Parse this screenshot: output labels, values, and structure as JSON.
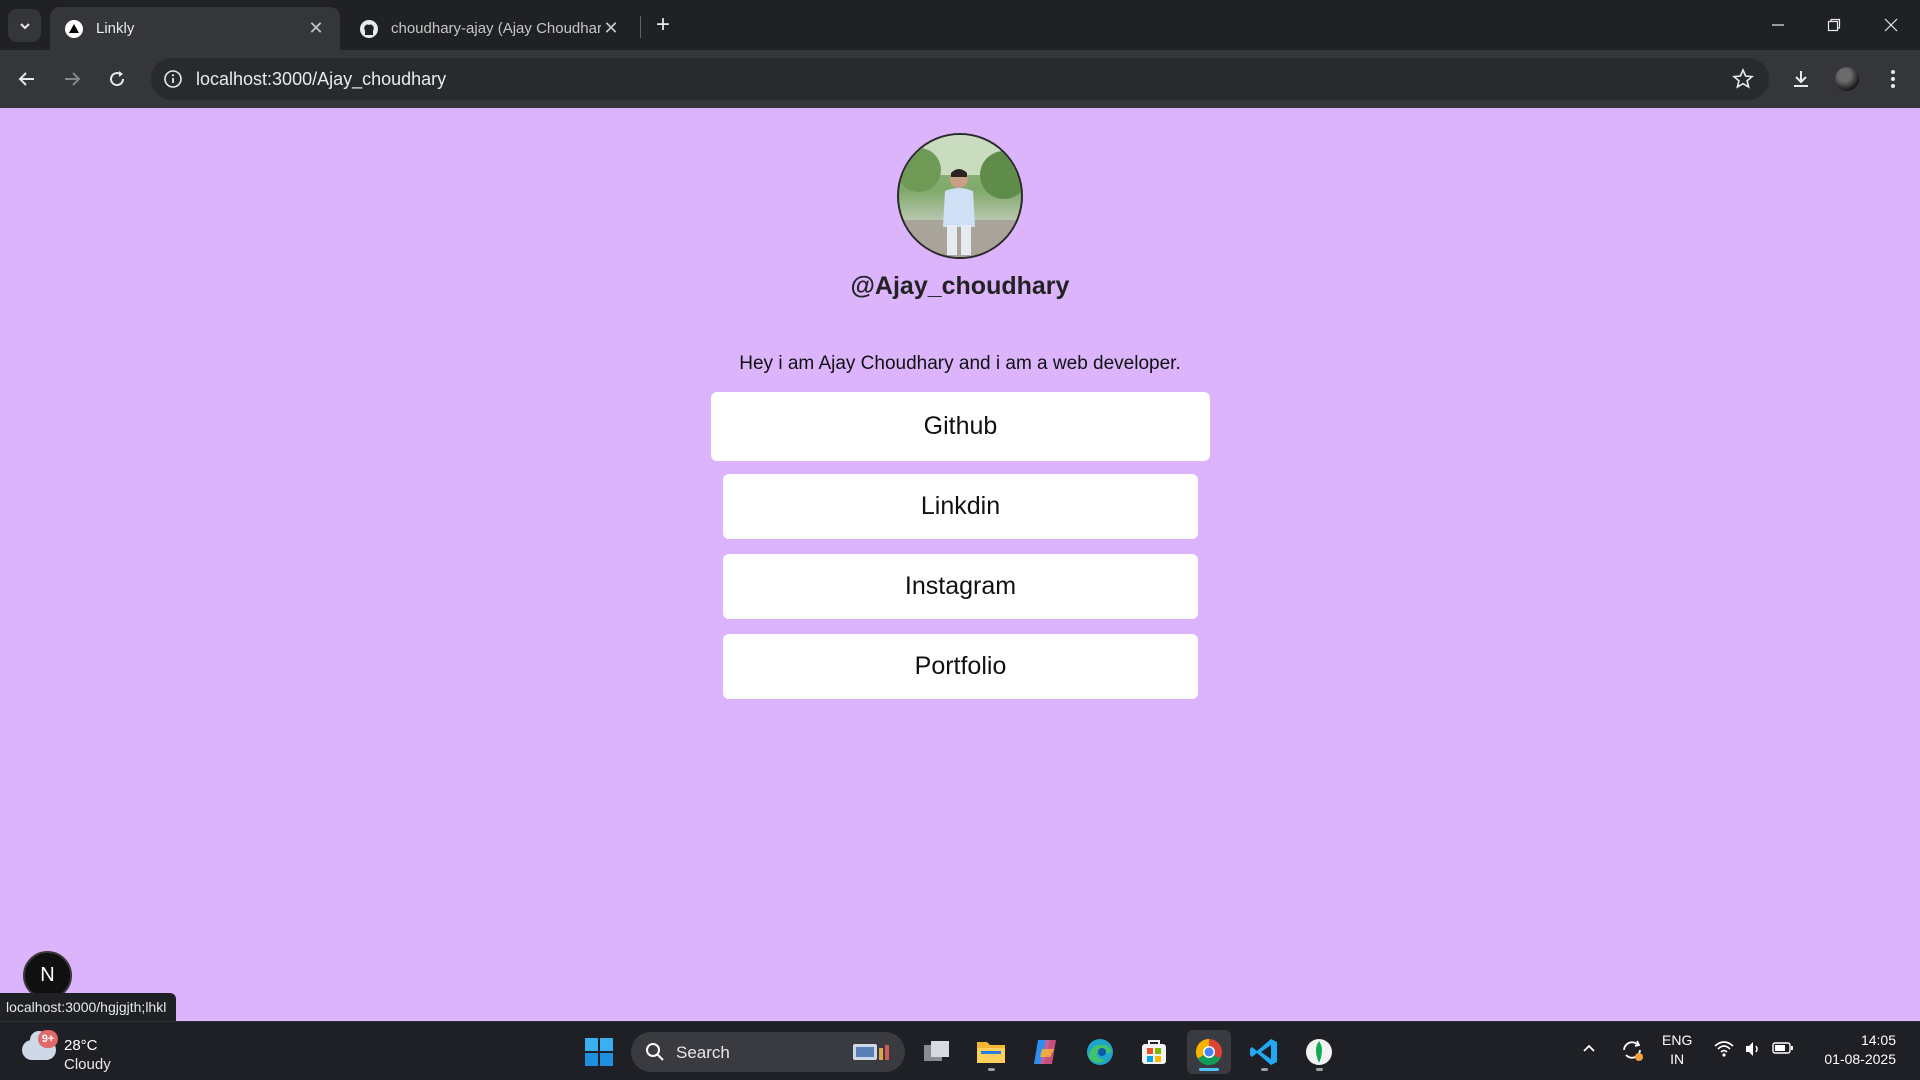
{
  "browser": {
    "tabs": [
      {
        "title": "Linkly",
        "active": true,
        "favicon": "triangle-icon"
      },
      {
        "title": "choudhary-ajay (Ajay Choudhary)",
        "active": false,
        "favicon": "github-icon"
      }
    ],
    "url": "localhost:3000/Ajay_choudhary"
  },
  "profile": {
    "handle": "@Ajay_choudhary",
    "bio": "Hey i am Ajay Choudhary and i am a web developer.",
    "links": [
      {
        "label": "Github"
      },
      {
        "label": "Linkdin"
      },
      {
        "label": "Instagram"
      },
      {
        "label": "Portfolio"
      }
    ]
  },
  "nextjs_badge": "N",
  "status_bar_url": "localhost:3000/hgjgjth;lhkl",
  "taskbar": {
    "weather": {
      "badge": "9+",
      "temp": "28°C",
      "condition": "Cloudy"
    },
    "search_placeholder": "Search",
    "language": {
      "line1": "ENG",
      "line2": "IN"
    },
    "clock": {
      "time": "14:05",
      "date": "01-08-2025"
    }
  },
  "colors": {
    "page_background": "#dbb4fc",
    "button_background": "#ffffff",
    "browser_chrome": "#202124"
  }
}
